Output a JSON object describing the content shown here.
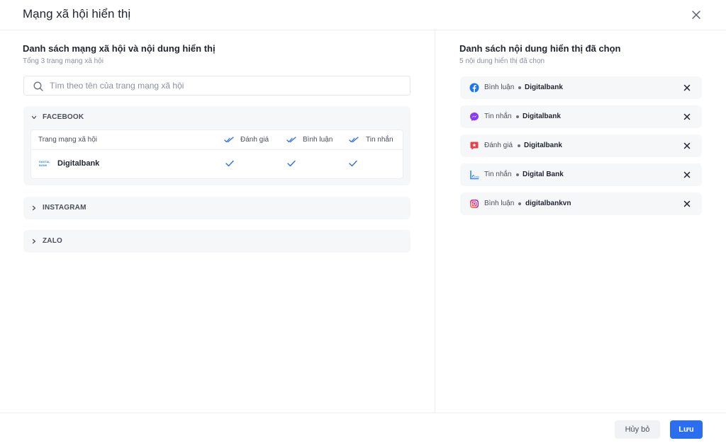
{
  "modal": {
    "title": "Mạng xã hội hiển thị"
  },
  "left": {
    "title": "Danh sách mạng xã hội và nội dung hiển thị",
    "subtitle": "Tổng 3 trang mạng xã hội",
    "search": {
      "placeholder": "Tìm theo tên của trang mạng xã hội",
      "value": ""
    },
    "groups": [
      {
        "label": "FACEBOOK",
        "expanded": true,
        "columns": [
          "Trang mạng xã hội",
          "Đánh giá",
          "Bình luận",
          "Tin nhắn"
        ],
        "rows": [
          {
            "logo_text": "DIGITAL BANK",
            "name": "Digitalbank",
            "danh_gia": true,
            "binh_luan": true,
            "tin_nhan": true
          }
        ]
      },
      {
        "label": "INSTAGRAM",
        "expanded": false
      },
      {
        "label": "ZALO",
        "expanded": false
      }
    ]
  },
  "right": {
    "title": "Danh sách nội dung hiển thị đã chọn",
    "subtitle": "5 nội dung hiển thị đã chọn",
    "items": [
      {
        "icon": "facebook-icon",
        "type": "Bình luận",
        "page": "Digitalbank"
      },
      {
        "icon": "messenger-icon",
        "type": "Tin nhắn",
        "page": "Digitalbank"
      },
      {
        "icon": "review-icon",
        "type": "Đánh giá",
        "page": "Digitalbank"
      },
      {
        "icon": "zalo-icon",
        "type": "Tin nhắn",
        "page": "Digital Bank"
      },
      {
        "icon": "instagram-icon",
        "type": "Bình luận",
        "page": "digitalbankvn"
      }
    ]
  },
  "footer": {
    "cancel_label": "Hủy bỏ",
    "save_label": "Lưu"
  },
  "colors": {
    "primary": "#2b6ef0",
    "facebook": "#1877f2",
    "review": "#e8404a",
    "check": "#2b6ef0"
  }
}
